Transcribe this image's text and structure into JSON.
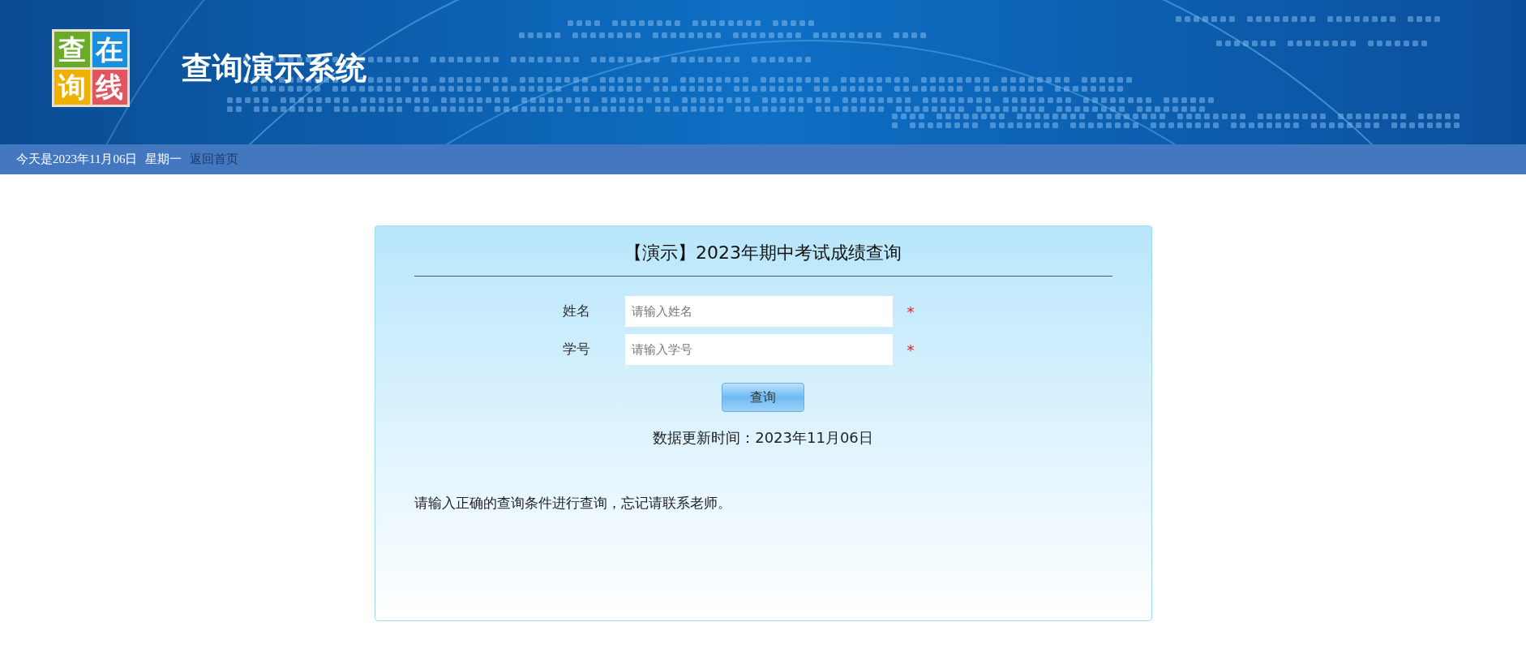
{
  "header": {
    "logo_tiles": [
      {
        "text": "查",
        "color": "#6aac2a"
      },
      {
        "text": "在",
        "color": "#1a8fe0"
      },
      {
        "text": "询",
        "color": "#f0b000"
      },
      {
        "text": "线",
        "color": "#e05560"
      }
    ],
    "title": "查询演示系统"
  },
  "status_bar": {
    "date": "今天是2023年11月06日",
    "weekday": "星期一",
    "home_link": "返回首页"
  },
  "form": {
    "title": "【演示】2023年期中考试成绩查询",
    "fields": [
      {
        "label": "姓名",
        "placeholder": "请输入姓名",
        "required_mark": "*"
      },
      {
        "label": "学号",
        "placeholder": "请输入学号",
        "required_mark": "*"
      }
    ],
    "submit": "查询",
    "update_time": "数据更新时间：2023年11月06日",
    "note": "请输入正确的查询条件进行查询，忘记请联系老师。"
  }
}
